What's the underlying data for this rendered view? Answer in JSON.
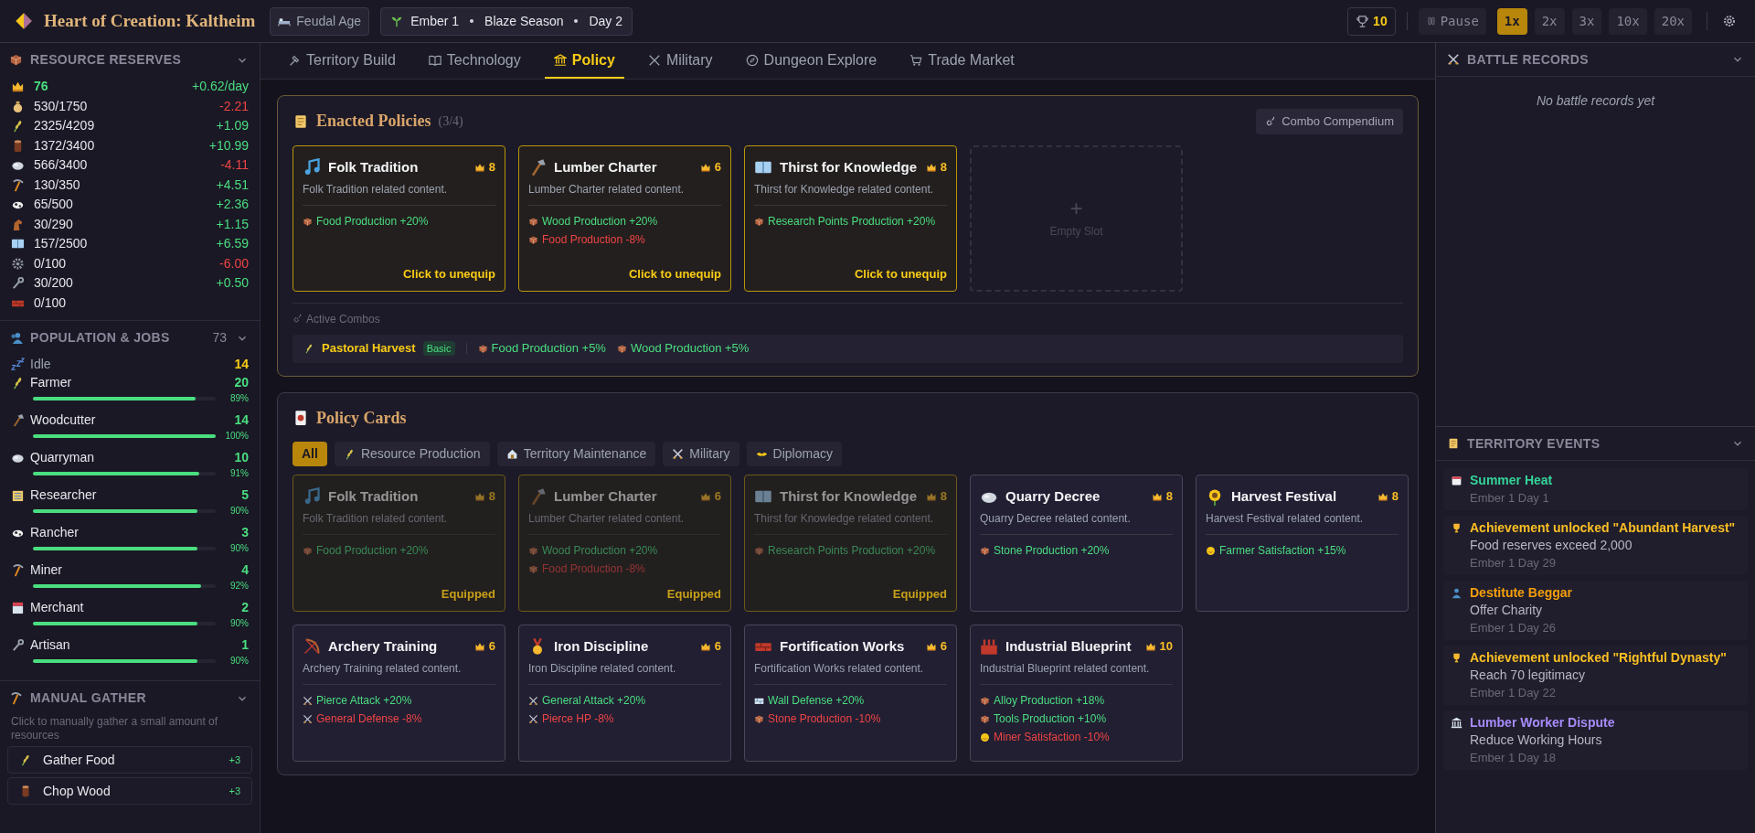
{
  "top_bar": {
    "title": "Heart of Creation: Kaltheim",
    "era": "Feudal Age",
    "season": {
      "month": "Ember 1",
      "season": "Blaze Season",
      "day": "Day 2"
    },
    "trophies": "10",
    "pause": "Pause",
    "speeds": [
      {
        "label": "1x",
        "selected": true
      },
      {
        "label": "2x",
        "selected": false
      },
      {
        "label": "3x",
        "selected": false
      },
      {
        "label": "10x",
        "selected": false
      },
      {
        "label": "20x",
        "selected": false
      }
    ]
  },
  "resources": {
    "title": "RESOURCE RESERVES",
    "items": [
      {
        "value": "76",
        "rate": "+0.62/day",
        "positive": true,
        "highlight": true
      },
      {
        "value": "530/1750",
        "rate": "-2.21",
        "positive": false,
        "highlight": false
      },
      {
        "value": "2325/4209",
        "rate": "+1.09",
        "positive": true,
        "highlight": false
      },
      {
        "value": "1372/3400",
        "rate": "+10.99",
        "positive": true,
        "highlight": false
      },
      {
        "value": "566/3400",
        "rate": "-4.11",
        "positive": false,
        "highlight": false
      },
      {
        "value": "130/350",
        "rate": "+4.51",
        "positive": true,
        "highlight": false
      },
      {
        "value": "65/500",
        "rate": "+2.36",
        "positive": true,
        "highlight": false
      },
      {
        "value": "30/290",
        "rate": "+1.15",
        "positive": true,
        "highlight": false
      },
      {
        "value": "157/2500",
        "rate": "+6.59",
        "positive": true,
        "highlight": false
      },
      {
        "value": "0/100",
        "rate": "-6.00",
        "positive": false,
        "highlight": false
      },
      {
        "value": "30/200",
        "rate": "+0.50",
        "positive": true,
        "highlight": false
      },
      {
        "value": "0/100",
        "highlight": false
      }
    ]
  },
  "population": {
    "title": "POPULATION & JOBS",
    "total": "73",
    "idle": {
      "label": "Idle",
      "count": "14"
    },
    "jobs": [
      {
        "name": "Farmer",
        "count": "20",
        "level": 0.89,
        "percent": "89%"
      },
      {
        "name": "Woodcutter",
        "count": "14",
        "level": 1.0,
        "percent": "100%"
      },
      {
        "name": "Quarryman",
        "count": "10",
        "level": 0.91,
        "percent": "91%"
      },
      {
        "name": "Researcher",
        "count": "5",
        "level": 0.9,
        "percent": "90%"
      },
      {
        "name": "Rancher",
        "count": "3",
        "level": 0.9,
        "percent": "90%"
      },
      {
        "name": "Miner",
        "count": "4",
        "level": 0.92,
        "percent": "92%"
      },
      {
        "name": "Merchant",
        "count": "2",
        "level": 0.9,
        "percent": "90%"
      },
      {
        "name": "Artisan",
        "count": "1",
        "level": 0.9,
        "percent": "90%"
      }
    ]
  },
  "manual_gather": {
    "title": "MANUAL GATHER",
    "hint": "Click to manually gather a small amount of resources",
    "actions": [
      {
        "label": "Gather Food",
        "amount": "+3"
      },
      {
        "label": "Chop Wood",
        "amount": "+3"
      }
    ]
  },
  "tabs": [
    {
      "label": "Territory Build",
      "selected": false
    },
    {
      "label": "Technology",
      "selected": false
    },
    {
      "label": "Policy",
      "selected": true
    },
    {
      "label": "Military",
      "selected": false
    },
    {
      "label": "Dungeon Explore",
      "selected": false
    },
    {
      "label": "Trade Market",
      "selected": false
    }
  ],
  "enacted": {
    "title": "Enacted Policies",
    "count": "(3/4)",
    "compendium": "Combo Compendium",
    "slots": [
      {
        "name": "Folk Tradition",
        "cost": "8",
        "description": "Folk Tradition related content.",
        "effects": [
          {
            "text": "Food Production +20%",
            "positive": true
          }
        ],
        "action": "Click to unequip"
      },
      {
        "name": "Lumber Charter",
        "cost": "6",
        "description": "Lumber Charter related content.",
        "effects": [
          {
            "text": "Wood Production +20%",
            "positive": true
          },
          {
            "text": "Food Production -8%",
            "positive": false
          }
        ],
        "action": "Click to unequip"
      },
      {
        "name": "Thirst for Knowledge",
        "cost": "8",
        "description": "Thirst for Knowledge related content.",
        "effects": [
          {
            "text": "Research Points Production +20%",
            "positive": true
          }
        ],
        "action": "Click to unequip"
      }
    ],
    "empty_slot": {
      "symbol": "+",
      "label": "Empty Slot"
    },
    "combos": {
      "title": "Active Combos",
      "items": [
        {
          "name": "Pastoral Harvest",
          "tier": "Basic",
          "effects": [
            {
              "text": "Food Production +5%",
              "positive": true
            },
            {
              "text": "Wood Production +5%",
              "positive": true
            }
          ]
        }
      ]
    }
  },
  "policy_cards": {
    "title": "Policy Cards",
    "filters": [
      {
        "label": "All",
        "selected": true
      },
      {
        "label": "Resource Production",
        "selected": false
      },
      {
        "label": "Territory Maintenance",
        "selected": false
      },
      {
        "label": "Military",
        "selected": false
      },
      {
        "label": "Diplomacy",
        "selected": false
      }
    ],
    "cards": [
      {
        "name": "Folk Tradition",
        "cost": "8",
        "description": "Folk Tradition related content.",
        "effects": [
          {
            "text": "Food Production +20%",
            "positive": true
          }
        ],
        "equipped": true,
        "status": "Equipped"
      },
      {
        "name": "Lumber Charter",
        "cost": "6",
        "description": "Lumber Charter related content.",
        "effects": [
          {
            "text": "Wood Production +20%",
            "positive": true
          },
          {
            "text": "Food Production -8%",
            "positive": false
          }
        ],
        "equipped": true,
        "status": "Equipped"
      },
      {
        "name": "Thirst for Knowledge",
        "cost": "8",
        "description": "Thirst for Knowledge related content.",
        "effects": [
          {
            "text": "Research Points Production +20%",
            "positive": true
          }
        ],
        "equipped": true,
        "status": "Equipped"
      },
      {
        "name": "Quarry Decree",
        "cost": "8",
        "description": "Quarry Decree related content.",
        "effects": [
          {
            "text": "Stone Production +20%",
            "positive": true
          }
        ],
        "equipped": false
      },
      {
        "name": "Harvest Festival",
        "cost": "8",
        "description": "Harvest Festival related content.",
        "effects": [
          {
            "text": "Farmer Satisfaction +15%",
            "positive": true
          }
        ],
        "equipped": false
      },
      {
        "name": "Archery Training",
        "cost": "6",
        "description": "Archery Training related content.",
        "effects": [
          {
            "text": "Pierce Attack +20%",
            "positive": true
          },
          {
            "text": "General Defense -8%",
            "positive": false
          }
        ],
        "equipped": false
      },
      {
        "name": "Iron Discipline",
        "cost": "6",
        "description": "Iron Discipline related content.",
        "effects": [
          {
            "text": "General Attack +20%",
            "positive": true
          },
          {
            "text": "Pierce HP -8%",
            "positive": false
          }
        ],
        "equipped": false
      },
      {
        "name": "Fortification Works",
        "cost": "6",
        "description": "Fortification Works related content.",
        "effects": [
          {
            "text": "Wall Defense +20%",
            "positive": true
          },
          {
            "text": "Stone Production -10%",
            "positive": false
          }
        ],
        "equipped": false
      },
      {
        "name": "Industrial Blueprint",
        "cost": "10",
        "description": "Industrial Blueprint related content.",
        "effects": [
          {
            "text": "Alloy Production +18%",
            "positive": true
          },
          {
            "text": "Tools Production +10%",
            "positive": true
          },
          {
            "text": "Miner Satisfaction -10%",
            "positive": false
          }
        ],
        "equipped": false
      }
    ]
  },
  "battle_records": {
    "title": "BATTLE RECORDS",
    "empty": "No battle records yet"
  },
  "events": {
    "title": "TERRITORY EVENTS",
    "items": [
      {
        "title": "Summer Heat",
        "color": "#34d399",
        "date": "Ember 1 Day 1"
      },
      {
        "title": "Achievement unlocked \"Abundant Harvest\"",
        "color": "#fbbf24",
        "detail": "Food reserves exceed 2,000",
        "date": "Ember 1 Day 29"
      },
      {
        "title": "Destitute Beggar",
        "color": "#f59e0b",
        "detail": "Offer Charity",
        "date": "Ember 1 Day 26"
      },
      {
        "title": "Achievement unlocked \"Rightful Dynasty\"",
        "color": "#fbbf24",
        "detail": "Reach 70 legitimacy",
        "date": "Ember 1 Day 22"
      },
      {
        "title": "Lumber Worker Dispute",
        "color": "#a78bfa",
        "detail": "Reduce Working Hours",
        "date": "Ember 1 Day 18"
      }
    ]
  }
}
